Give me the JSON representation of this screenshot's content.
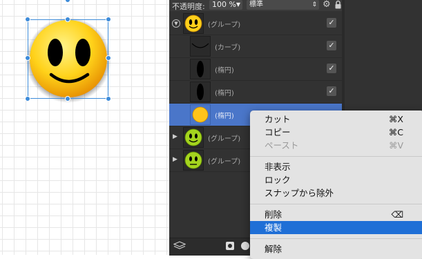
{
  "toolbar": {
    "opacity_label": "不透明度:",
    "opacity_value": "100 %",
    "blend_mode": "標準",
    "gear_icon": "gear-icon",
    "lock_icon": "lock-icon"
  },
  "layers": [
    {
      "name": "(グループ)",
      "thumb": "smiley",
      "disclosure": "expanded",
      "visible": "✓"
    },
    {
      "name": "(カーブ)",
      "thumb": "curve",
      "visible": "✓"
    },
    {
      "name": "(楕円)",
      "thumb": "ellipse",
      "visible": "✓"
    },
    {
      "name": "(楕円)",
      "thumb": "ellipse",
      "visible": "✓"
    },
    {
      "name": "(楕円)",
      "thumb": "yellow-circle",
      "selected": true
    },
    {
      "name": "(グループ)",
      "thumb": "green-smiley",
      "disclosure": "collapsed"
    },
    {
      "name": "(グループ)",
      "thumb": "green-neutral",
      "disclosure": "collapsed"
    }
  ],
  "context_menu": {
    "items": [
      {
        "label": "カット",
        "shortcut": "⌘X"
      },
      {
        "label": "コピー",
        "shortcut": "⌘C"
      },
      {
        "label": "ペースト",
        "shortcut": "⌘V",
        "disabled": true
      },
      {
        "label": "非表示"
      },
      {
        "label": "ロック"
      },
      {
        "label": "スナップから除外"
      },
      {
        "label": "削除",
        "shortcut": "⌫"
      },
      {
        "label": "複製",
        "highlighted": true
      },
      {
        "label": "解除"
      }
    ]
  },
  "colors": {
    "selection": "#3d8bd9",
    "highlight": "#1f6fd6",
    "panel": "#323232",
    "selected_row": "#4a76c9"
  }
}
